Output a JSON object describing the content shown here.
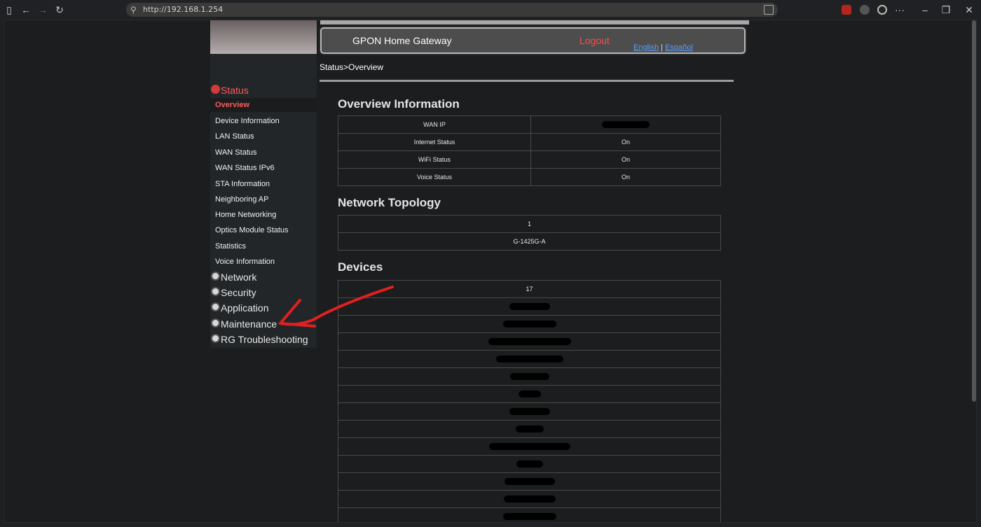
{
  "browser": {
    "url": "http://192.168.1.254",
    "buttons": [
      "sidebar-toggle",
      "back",
      "forward",
      "reload"
    ],
    "more_label": "···"
  },
  "header": {
    "title": "GPON Home Gateway",
    "logout": "Logout",
    "lang_english": "English",
    "lang_sep": "|",
    "lang_spanish": "Español"
  },
  "breadcrumb": "Status>Overview",
  "sidebar": {
    "status": "Status",
    "items": [
      "Overview",
      "Device Information",
      "LAN Status",
      "WAN Status",
      "WAN Status IPv6",
      "STA Information",
      "Neighboring AP",
      "Home Networking",
      "Optics Module Status",
      "Statistics",
      "Voice Information"
    ],
    "groups": [
      "Network",
      "Security",
      "Application",
      "Maintenance",
      "RG Troubleshooting"
    ]
  },
  "overview": {
    "title": "Overview Information",
    "rows": [
      {
        "label": "WAN IP",
        "value": ""
      },
      {
        "label": "Internet Status",
        "value": "On"
      },
      {
        "label": "WiFi Status",
        "value": "On"
      },
      {
        "label": "Voice Status",
        "value": "On"
      }
    ]
  },
  "topology": {
    "title": "Network Topology",
    "count": "1",
    "device": "G-1425G-A"
  },
  "devices": {
    "title": "Devices",
    "count": "17"
  },
  "colors": {
    "accent_red": "#ff4d4d",
    "link_blue": "#5aa0ff",
    "annotation_red": "#e02020"
  }
}
